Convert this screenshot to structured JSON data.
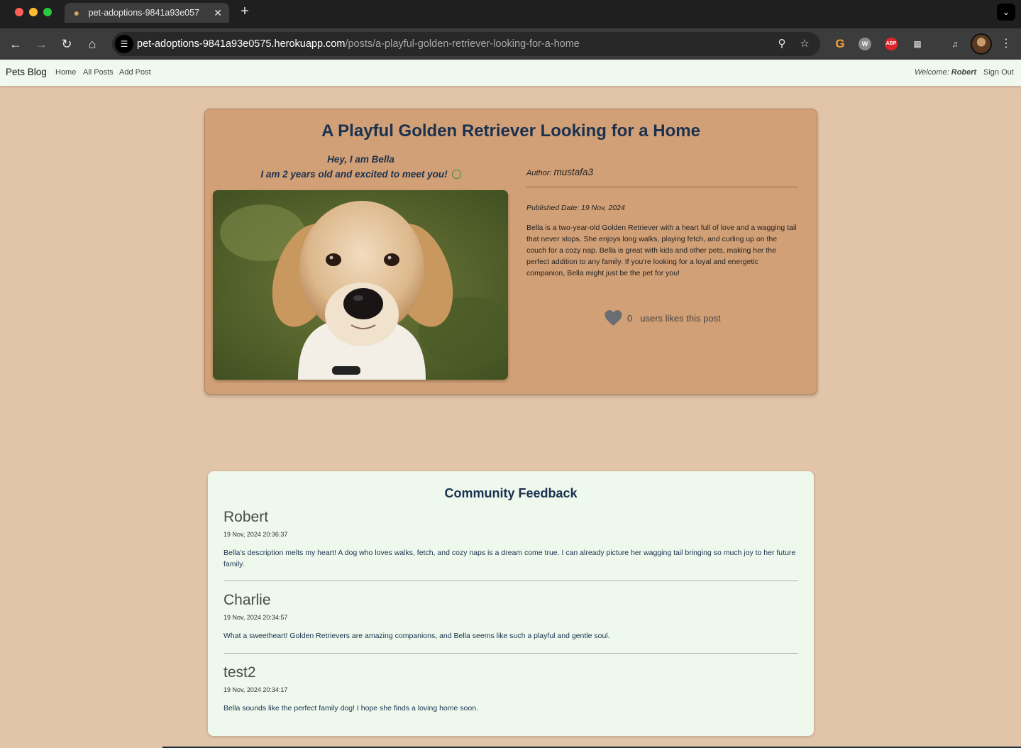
{
  "browser": {
    "tab_title": "pet-adoptions-9841a93e057",
    "url_host": "pet-adoptions-9841a93e0575.herokuapp.com",
    "url_path": "/posts/a-playful-golden-retriever-looking-for-a-home"
  },
  "nav": {
    "brand": "Pets Blog",
    "links": [
      "Home",
      "All Posts",
      "Add Post"
    ],
    "welcome_label": "Welcome:",
    "user": "Robert",
    "sign_out": "Sign Out"
  },
  "post": {
    "title": "A Playful Golden Retriever Looking for a Home",
    "intro_line1": "Hey, I am Bella",
    "intro_line2": "I am 2 years old and excited to meet you!",
    "author_label": "Author:",
    "author": "mustafa3",
    "published": "Published Date: 19 Nov, 2024",
    "description": "Bella is a two-year-old Golden Retriever with a heart full of love and a wagging tail that never stops. She enjoys long walks, playing fetch, and curling up on the couch for a cozy nap. Bella is great with kids and other pets, making her the perfect addition to any family. If you're looking for a loyal and energetic companion, Bella might just be the pet for you!",
    "like_count": "0",
    "like_label": "users likes this post"
  },
  "feedback": {
    "title": "Community Feedback",
    "comments": [
      {
        "author": "Robert",
        "date": "19 Nov, 2024 20:36:37",
        "text": "Bella's description melts my heart! A dog who loves walks, fetch, and cozy naps is a dream come true. I can already picture her wagging tail bringing so much joy to her future family."
      },
      {
        "author": "Charlie",
        "date": "19 Nov, 2024 20:34:57",
        "text": "What a sweetheart! Golden Retrievers are amazing companions, and Bella seems like such a playful and gentle soul."
      },
      {
        "author": "test2",
        "date": "19 Nov, 2024 20:34:17",
        "text": "Bella sounds like the perfect family dog! I hope she finds a loving home soon."
      }
    ]
  },
  "colors": {
    "page_bg": "#e2c4a9",
    "post_card_bg": "#d2a076",
    "feedback_bg": "#eef8ec",
    "navbar_bg": "#eff9ef",
    "title_color": "#1a3150"
  }
}
